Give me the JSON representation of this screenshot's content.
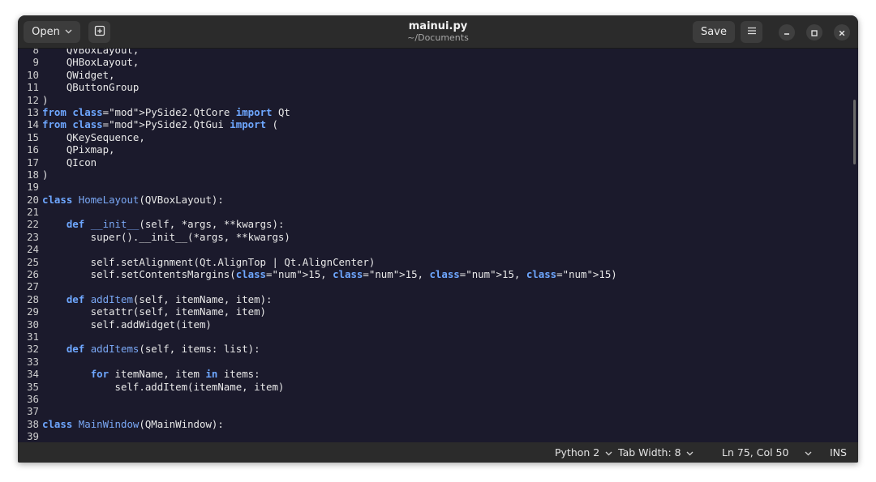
{
  "header": {
    "open_label": "Open",
    "title": "mainui.py",
    "subtitle": "~/Documents",
    "save_label": "Save"
  },
  "icons": {
    "open_chevron": "chevron-down-icon",
    "new_tab": "new-tab-icon",
    "menu": "hamburger-menu-icon",
    "minimize": "minimize-icon",
    "maximize": "maximize-icon",
    "close": "close-icon"
  },
  "colors": {
    "editor_background": "#1b1a2c",
    "keyword": "#6ea7ff",
    "number": "#9fd59a",
    "headerbar": "#2b2b2b"
  },
  "editor": {
    "lines": [
      {
        "n": "8",
        "text": "    QVBoxLayout,"
      },
      {
        "n": "9",
        "text": "    QHBoxLayout,"
      },
      {
        "n": "10",
        "text": "    QWidget,"
      },
      {
        "n": "11",
        "text": "    QButtonGroup"
      },
      {
        "n": "12",
        "text": ")"
      },
      {
        "n": "13",
        "text": "from PySide2.QtCore import Qt"
      },
      {
        "n": "14",
        "text": "from PySide2.QtGui import ("
      },
      {
        "n": "15",
        "text": "    QKeySequence,"
      },
      {
        "n": "16",
        "text": "    QPixmap,"
      },
      {
        "n": "17",
        "text": "    QIcon"
      },
      {
        "n": "18",
        "text": ")"
      },
      {
        "n": "19",
        "text": ""
      },
      {
        "n": "20",
        "text": "class HomeLayout(QVBoxLayout):"
      },
      {
        "n": "21",
        "text": ""
      },
      {
        "n": "22",
        "text": "    def __init__(self, *args, **kwargs):"
      },
      {
        "n": "23",
        "text": "        super().__init__(*args, **kwargs)"
      },
      {
        "n": "24",
        "text": ""
      },
      {
        "n": "25",
        "text": "        self.setAlignment(Qt.AlignTop | Qt.AlignCenter)"
      },
      {
        "n": "26",
        "text": "        self.setContentsMargins(15, 15, 15, 15)"
      },
      {
        "n": "27",
        "text": ""
      },
      {
        "n": "28",
        "text": "    def addItem(self, itemName, item):"
      },
      {
        "n": "29",
        "text": "        setattr(self, itemName, item)"
      },
      {
        "n": "30",
        "text": "        self.addWidget(item)"
      },
      {
        "n": "31",
        "text": ""
      },
      {
        "n": "32",
        "text": "    def addItems(self, items: list):"
      },
      {
        "n": "33",
        "text": ""
      },
      {
        "n": "34",
        "text": "        for itemName, item in items:"
      },
      {
        "n": "35",
        "text": "            self.addItem(itemName, item)"
      },
      {
        "n": "36",
        "text": ""
      },
      {
        "n": "37",
        "text": ""
      },
      {
        "n": "38",
        "text": "class MainWindow(QMainWindow):"
      },
      {
        "n": "39",
        "text": ""
      }
    ]
  },
  "status": {
    "language": "Python 2",
    "tab_width": "Tab Width: 8",
    "position": "Ln 75, Col 50",
    "mode": "INS"
  }
}
